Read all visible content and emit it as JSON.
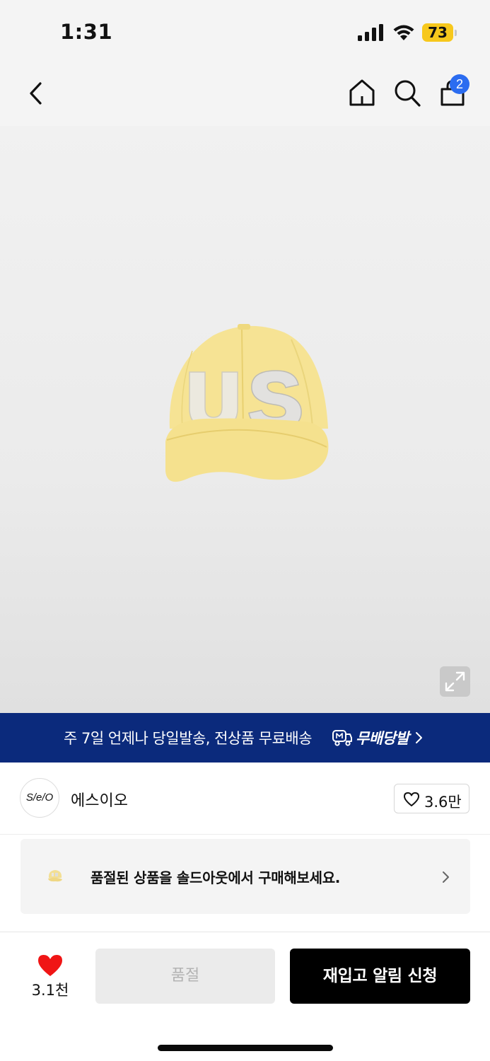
{
  "status_bar": {
    "time": "1:31",
    "battery_level": "73",
    "battery_color": "#f7c81c"
  },
  "nav": {
    "cart_count": "2",
    "icons": [
      "back-icon",
      "home-icon",
      "search-icon",
      "shopping-bag-icon"
    ],
    "badge_color": "#2b6cf0"
  },
  "product": {
    "image_subject": "yellow baseball cap with US lettering",
    "expand_icon": "expand-icon"
  },
  "promo": {
    "text": "주 7일 언제나 당일발송, 전상품 무료배송",
    "brand": "무배당발",
    "background_color": "#0b2a7c"
  },
  "brand": {
    "logo_text": "S/e/O",
    "name": "에스이오",
    "like_count": "3.6만"
  },
  "soldout_notice": {
    "text": "품절된 상품을 솔드아웃에서 구매해보세요."
  },
  "bottom": {
    "wish_count": "3.1천",
    "heart_color": "#f01515",
    "soldout_label": "품절",
    "restock_label": "재입고 알림 신청"
  }
}
